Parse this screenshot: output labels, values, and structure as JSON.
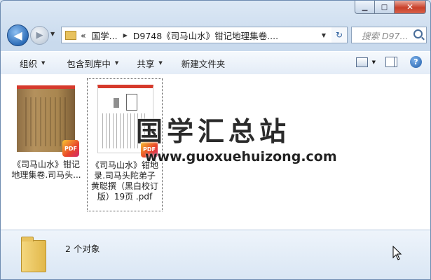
{
  "window": {
    "minimize_glyph": "▁",
    "maximize_glyph": "□",
    "close_glyph": "✕"
  },
  "navigation": {
    "back_glyph": "◀",
    "forward_glyph": "▶",
    "recent_glyph": "▼",
    "address_chevron": "«",
    "breadcrumb": [
      "国学...",
      "D9748《司马山水》钳记地理集卷...."
    ],
    "breadcrumb_sep": "▶",
    "address_dropdown": "▼",
    "refresh_glyph": "↻",
    "search_placeholder": "搜索 D97..."
  },
  "toolbar": {
    "organize": "组织",
    "include_library": "包含到库中",
    "share": "共享",
    "new_folder": "新建文件夹",
    "caret": "▼",
    "help": "?"
  },
  "files": [
    {
      "name_line1": "《司马山水》钳记",
      "name_line2": "地理集卷.司马头...",
      "badge": "PDF",
      "selected": false
    },
    {
      "name_line1": "《司马山水》钳地",
      "name_line2": "录.司马头陀弟子",
      "name_line3": "黄聪撰（黑白校订",
      "name_line4": "版）19页 .pdf",
      "badge": "PDF",
      "selected": true
    }
  ],
  "watermark": {
    "title": "国学汇总站",
    "url": "www.guoxuehuizong.com"
  },
  "status": {
    "count_text": "2 个对象"
  }
}
